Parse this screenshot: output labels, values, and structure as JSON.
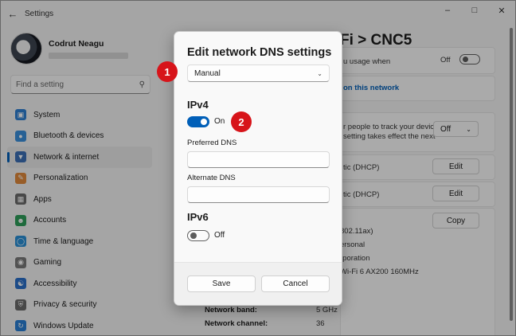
{
  "window": {
    "title": "Settings",
    "back_icon": "back-arrow-icon"
  },
  "profile": {
    "name": "Codrut Neagu"
  },
  "search": {
    "placeholder": "Find a setting"
  },
  "sidebar": {
    "items": [
      {
        "label": "System",
        "icon": "system-icon",
        "color": "#2f7fd1"
      },
      {
        "label": "Bluetooth & devices",
        "icon": "bluetooth-icon",
        "color": "#3a8fdc"
      },
      {
        "label": "Network & internet",
        "icon": "wifi-icon",
        "color": "#3c6fb6",
        "active": true
      },
      {
        "label": "Personalization",
        "icon": "brush-icon",
        "color": "#e08a3c"
      },
      {
        "label": "Apps",
        "icon": "apps-icon",
        "color": "#6b6b6b"
      },
      {
        "label": "Accounts",
        "icon": "person-icon",
        "color": "#2e9e5a"
      },
      {
        "label": "Time & language",
        "icon": "globe-clock-icon",
        "color": "#2a8fd6"
      },
      {
        "label": "Gaming",
        "icon": "gamepad-icon",
        "color": "#7a7a7a"
      },
      {
        "label": "Accessibility",
        "icon": "accessibility-icon",
        "color": "#2a6fc9"
      },
      {
        "label": "Privacy & security",
        "icon": "shield-icon",
        "color": "#6b6b6b"
      },
      {
        "label": "Windows Update",
        "icon": "update-icon",
        "color": "#2a7fd4"
      }
    ]
  },
  "page": {
    "heading_fragment": "Fi  >  CNC5",
    "metered_fragment": "u usage when",
    "metered_toggle": "Off",
    "link_fragment": "on this network",
    "tracking_fragment_1": "r people to track your device",
    "tracking_fragment_2": "setting takes effect the next",
    "tracking_value": "Off",
    "ip_fragment": "tic (DHCP)",
    "dns_fragment": "tic (DHCP)",
    "edit_label_1": "Edit",
    "edit_label_2": "Edit",
    "copy_label": "Copy",
    "props_fragments": [
      "802.11ax)",
      "ersonal",
      "rporation",
      "Wi-Fi 6 AX200 160MHz"
    ],
    "band_label": "Network band:",
    "band_value": "5 GHz",
    "channel_label": "Network channel:",
    "channel_value": "36"
  },
  "dialog": {
    "title": "Edit network DNS settings",
    "mode_select": "Manual",
    "ipv4_heading": "IPv4",
    "ipv4_state": "On",
    "preferred_dns_label": "Preferred DNS",
    "preferred_dns_value": "",
    "alternate_dns_label": "Alternate DNS",
    "alternate_dns_value": "",
    "ipv6_heading": "IPv6",
    "ipv6_state": "Off",
    "save_label": "Save",
    "cancel_label": "Cancel"
  },
  "annotations": {
    "badge_1": "1",
    "badge_2": "2",
    "color": "#d7141a"
  }
}
